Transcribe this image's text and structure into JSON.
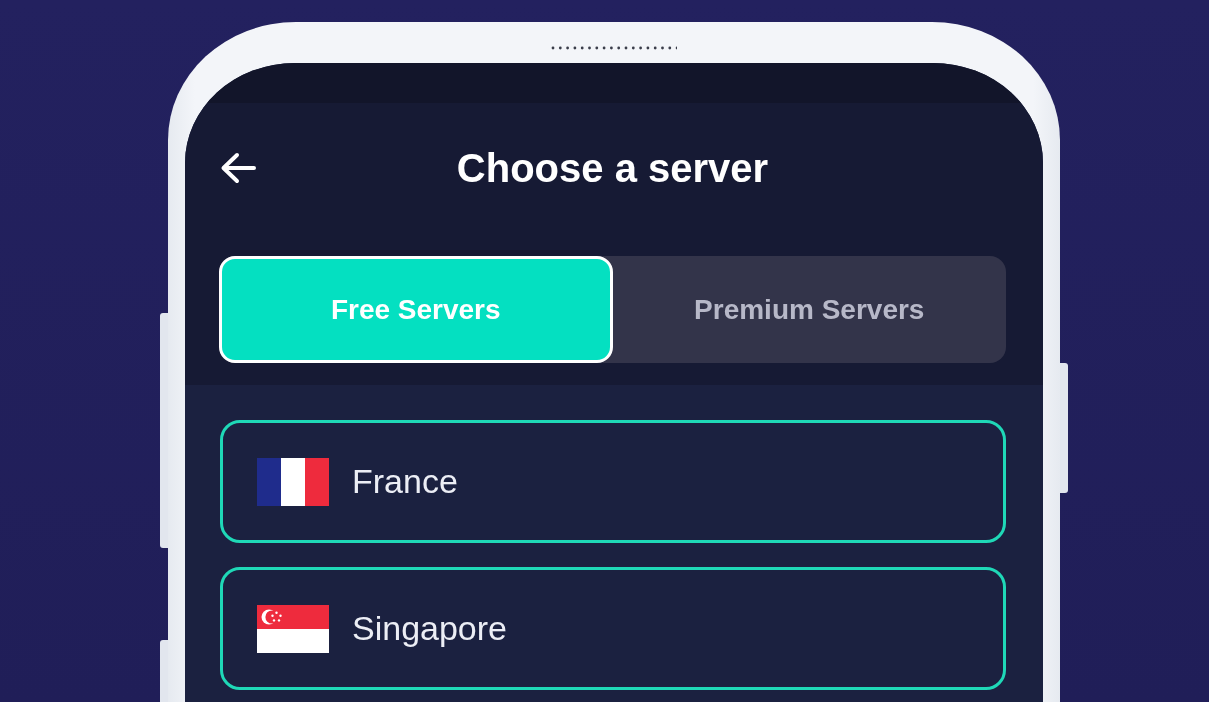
{
  "screen": {
    "title": "Choose a server",
    "tabs": [
      {
        "label": "Free Servers",
        "selected": true
      },
      {
        "label": "Premium Servers",
        "selected": false
      }
    ],
    "servers": [
      {
        "country": "France",
        "kind": "fr"
      },
      {
        "country": "Singapore",
        "kind": "sg"
      }
    ]
  }
}
